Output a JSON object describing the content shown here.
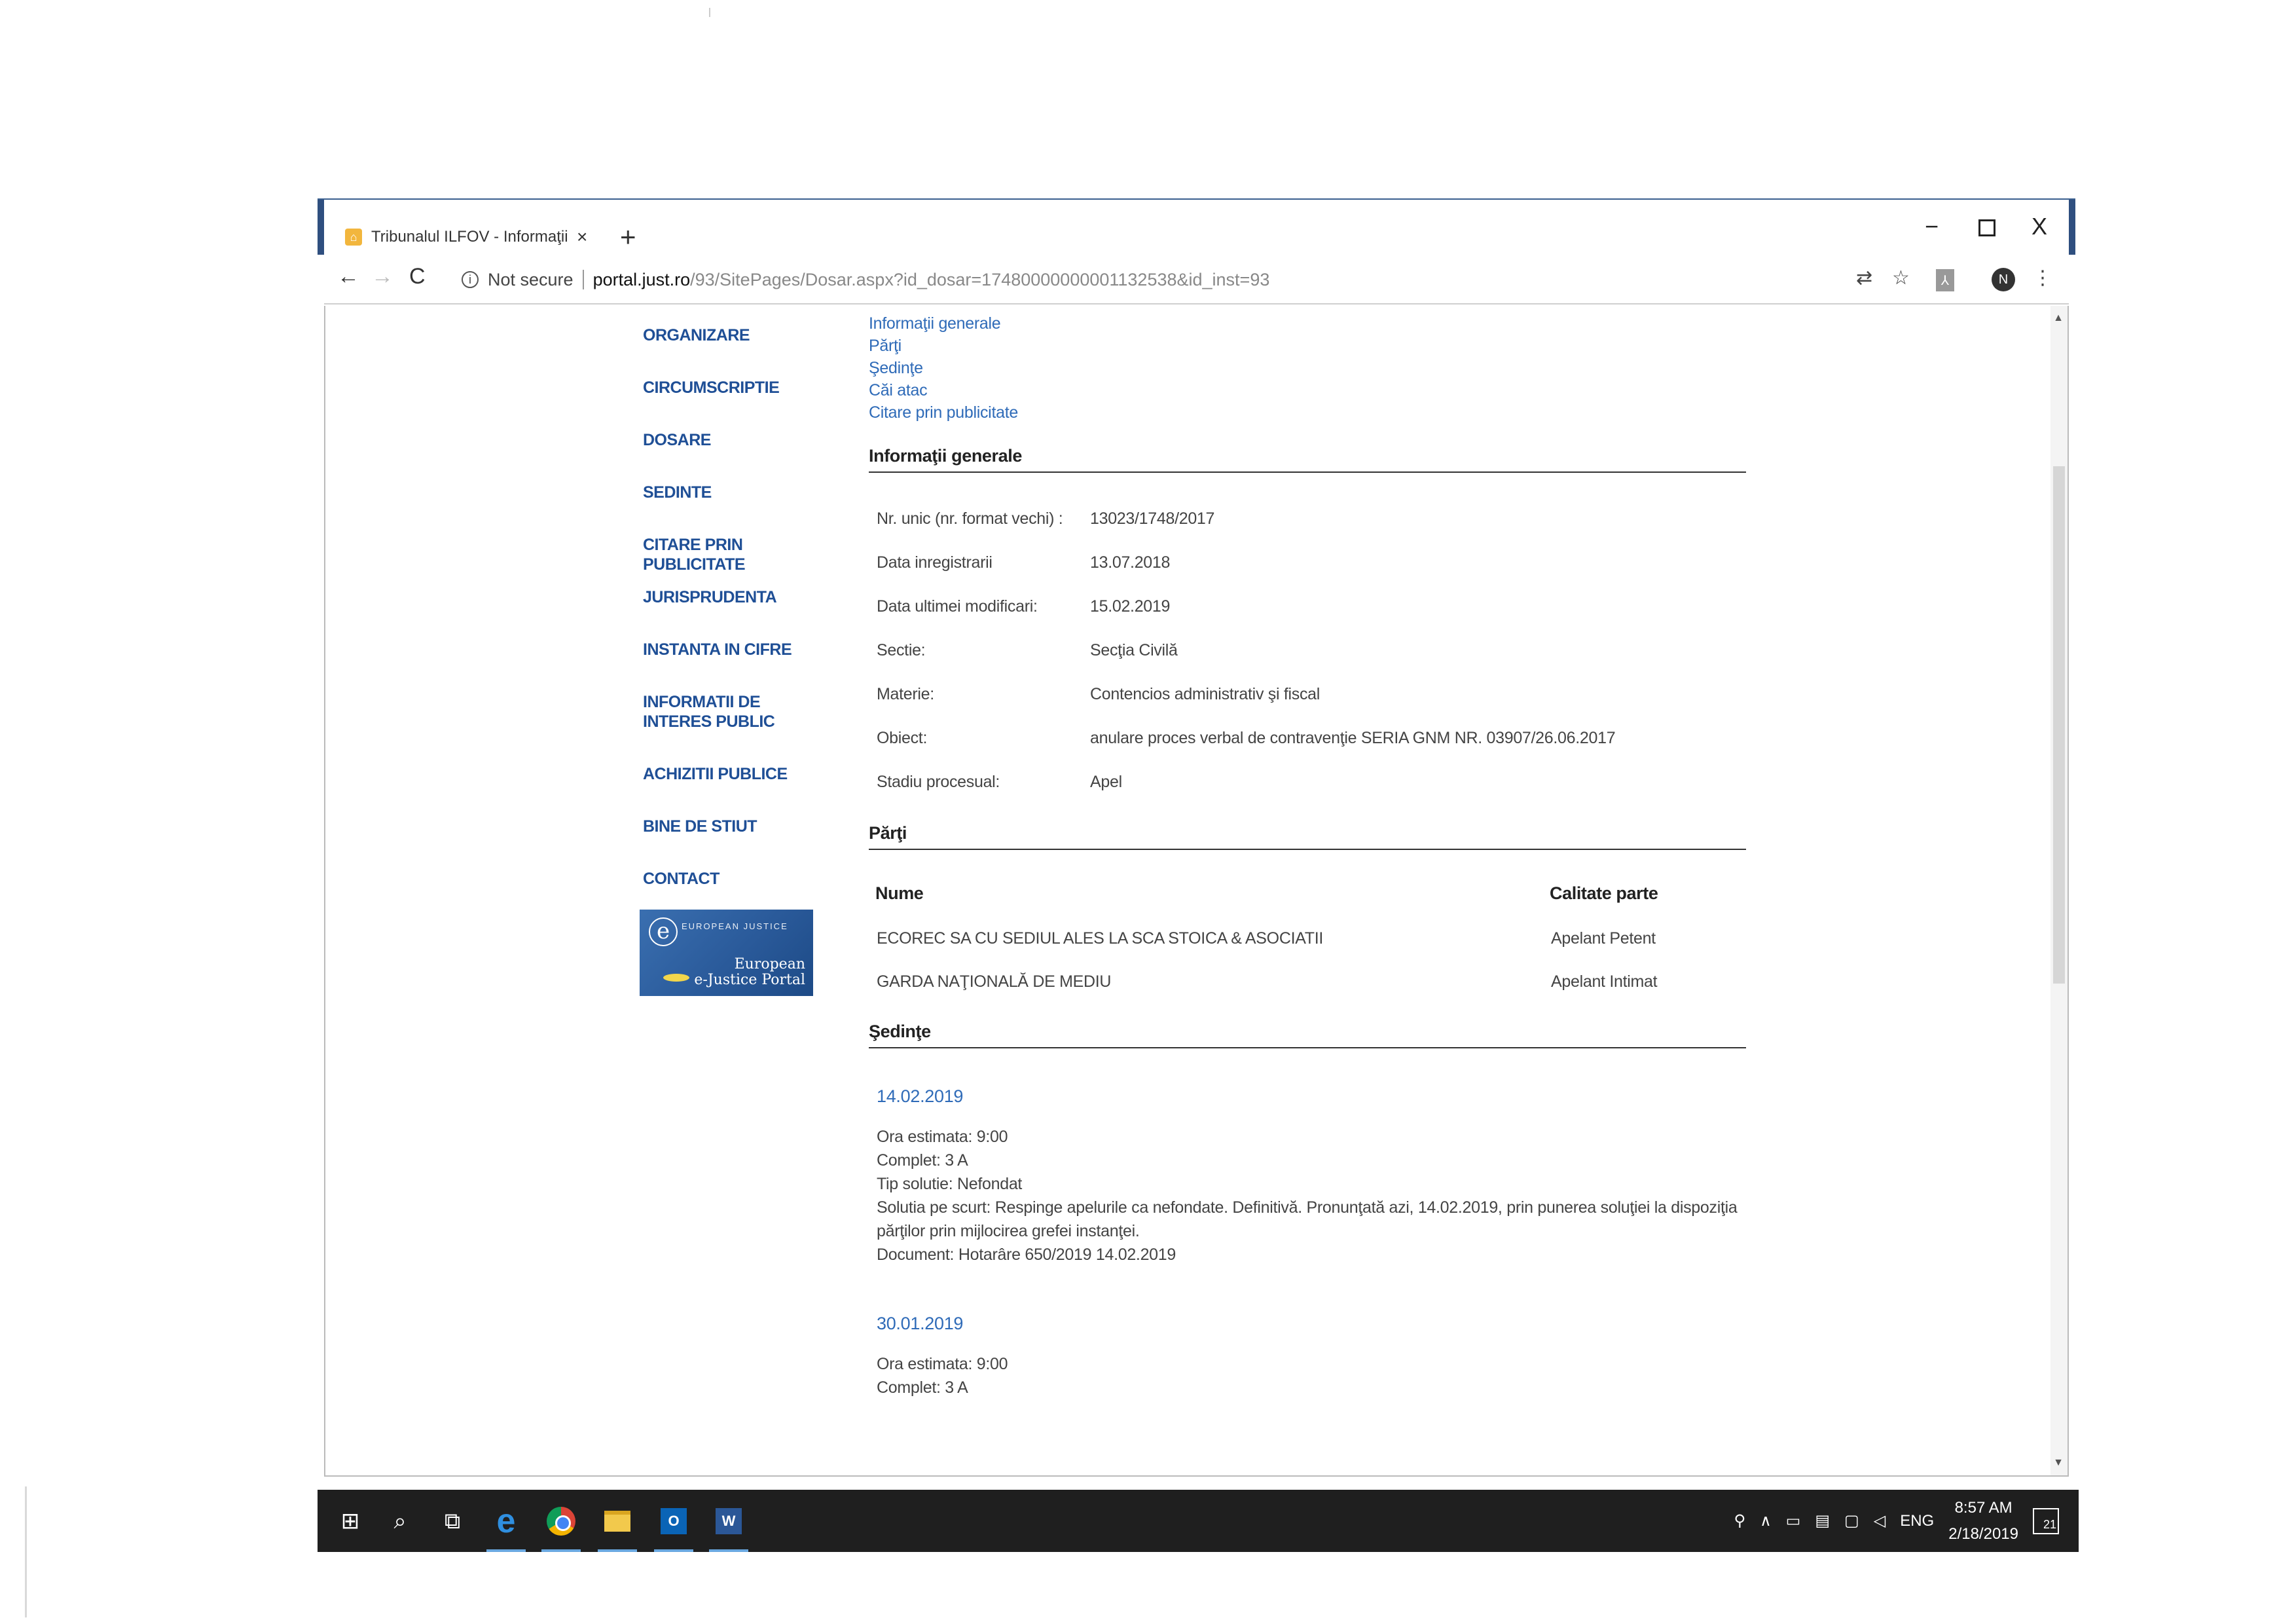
{
  "browser": {
    "tab_title": "Tribunalul ILFOV - Informaţii dc",
    "tab_close": "×",
    "new_tab": "+",
    "window_controls": {
      "minimize": "−",
      "close": "X"
    },
    "security_label": "Not secure",
    "url_host": "portal.just.ro",
    "url_path": "/93/SitePages/Dosar.aspx?id_dosar=17480000000001132538&id_inst=93",
    "avatar_letter": "N"
  },
  "side_menu": [
    "ORGANIZARE",
    "CIRCUMSCRIPTIE",
    "DOSARE",
    "SEDINTE",
    "CITARE PRIN PUBLICITATE",
    "JURISPRUDENTA",
    "INSTANTA IN CIFRE",
    "INFORMATII DE INTERES PUBLIC",
    "ACHIZITII PUBLICE",
    "BINE DE STIUT",
    "CONTACT"
  ],
  "ejustice_banner": {
    "line1": "European",
    "line2": "e-Justice Portal",
    "small": "EUROPEAN JUSTICE"
  },
  "sub_links": [
    "Informaţii generale",
    "Părţi",
    "Şedinţe",
    "Căi atac",
    "Citare prin publicitate"
  ],
  "general": {
    "title": "Informaţii generale",
    "rows": [
      {
        "label": "Nr. unic (nr. format vechi) :",
        "value": "13023/1748/2017"
      },
      {
        "label": "Data inregistrarii",
        "value": "13.07.2018"
      },
      {
        "label": "Data ultimei modificari:",
        "value": "15.02.2019"
      },
      {
        "label": "Sectie:",
        "value": "Secţia Civilă"
      },
      {
        "label": "Materie:",
        "value": "Contencios administrativ şi fiscal"
      },
      {
        "label": "Obiect:",
        "value": "anulare proces verbal de contravenţie SERIA GNM NR. 03907/26.06.2017"
      },
      {
        "label": "Stadiu procesual:",
        "value": "Apel"
      }
    ]
  },
  "parties": {
    "title": "Părţi",
    "col_name": "Nume",
    "col_role": "Calitate parte",
    "rows": [
      {
        "name": "ECOREC SA CU SEDIUL ALES LA SCA STOICA & ASOCIATII",
        "role": "Apelant Petent"
      },
      {
        "name": "GARDA NAŢIONALĂ DE MEDIU",
        "role": "Apelant Intimat"
      }
    ]
  },
  "sessions": {
    "title": "Şedinţe",
    "items": [
      {
        "date": "14.02.2019",
        "lines": [
          "Ora estimata: 9:00",
          "Complet: 3 A",
          "Tip solutie: Nefondat",
          "Solutia pe scurt: Respinge apelurile ca nefondate. Definitivă. Pronunţată azi, 14.02.2019, prin punerea soluţiei la dispoziţia",
          "părţilor prin mijlocirea grefei instanţei.",
          "Document: Hotarâre  650/2019  14.02.2019"
        ]
      },
      {
        "date": "30.01.2019",
        "lines": [
          "Ora estimata: 9:00",
          "Complet: 3 A"
        ]
      }
    ]
  },
  "taskbar": {
    "lang": "ENG",
    "time": "8:57 AM",
    "date": "2/18/2019",
    "notifications": "21",
    "outlook_letter": "O",
    "word_letter": "W"
  }
}
